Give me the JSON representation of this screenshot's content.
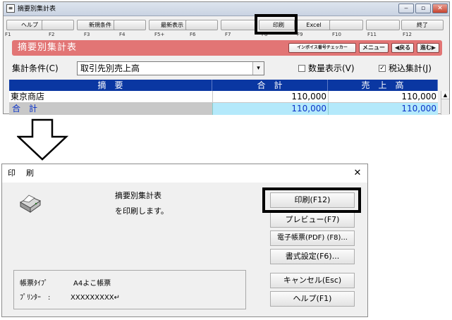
{
  "app": {
    "title": "摘要別集計表",
    "window_controls": [
      "‒",
      "▫",
      "✕"
    ],
    "fkeys": [
      {
        "label": "ヘルプ",
        "key": "F1"
      },
      {
        "label": "",
        "key": "F2"
      },
      {
        "label": "新規条件",
        "key": "F3"
      },
      {
        "label": "",
        "key": "F4"
      },
      {
        "label": "最新表示",
        "key": "F5+"
      },
      {
        "label": "",
        "key": "F6"
      },
      {
        "label": "",
        "key": "F7"
      },
      {
        "label": "印刷",
        "key": "F8"
      },
      {
        "label": "Excel",
        "key": "F9"
      },
      {
        "label": "",
        "key": "F10"
      },
      {
        "label": "",
        "key": "F11"
      },
      {
        "label": "終了",
        "key": "F12"
      }
    ],
    "header_title": "摘要別集計表",
    "header_buttons": {
      "invoice": "インボイス番号チェッカー",
      "menu": "メニュー",
      "back": "◀戻る",
      "forward": "進む▶"
    },
    "condition_label": "集計条件(C)",
    "condition_value": "取引先別売上高",
    "qty_label": "数量表示(V)",
    "qty_checked": false,
    "tax_label": "税込集計(J)",
    "tax_checked": true,
    "table": {
      "headers": [
        "摘　要",
        "合　計",
        "売　上　高"
      ],
      "rows": [
        {
          "name": "東京商店",
          "total": "110,000",
          "sales": "110,000"
        }
      ],
      "total_row": {
        "name": "合　計",
        "total": "110,000",
        "sales": "110,000"
      }
    }
  },
  "dialog": {
    "title": "印　刷",
    "close": "✕",
    "report_name": "摘要別集計表",
    "message": "を印刷します。",
    "form_type_label": "帳票ﾀｲﾌﾟ",
    "form_type_value": "A4よこ帳票",
    "printer_label": "ﾌﾟﾘﾝﾀｰ　:",
    "printer_value": "XXXXXXXXX↵",
    "buttons": {
      "print": "印刷(F12)",
      "preview": "プレビュー(F7)",
      "pdf": "電子帳票(PDF) (F8)...",
      "format": "書式設定(F6)...",
      "cancel": "キャンセル(Esc)",
      "help": "ヘルプ(F1)"
    }
  },
  "colors": {
    "header_pink": "#e27575",
    "table_header_blue": "#0a37a2",
    "total_row_blue": "#0a32c8",
    "total_row_gray": "#c8c8c8",
    "total_row_cyan": "#b4e9fb"
  }
}
